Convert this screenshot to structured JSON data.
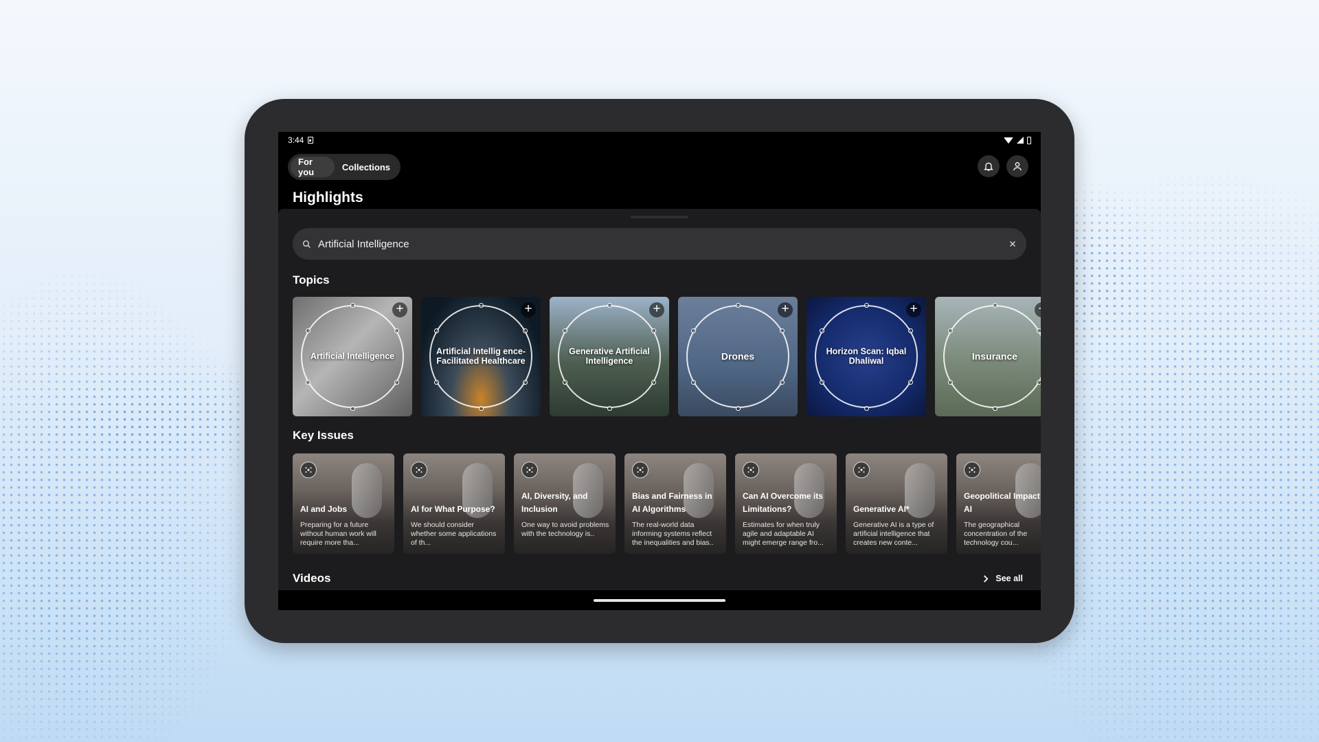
{
  "status_bar": {
    "time": "3:44"
  },
  "tabs": [
    {
      "label": "For you",
      "active": true
    },
    {
      "label": "Collections",
      "active": false
    }
  ],
  "header": {
    "title": "Highlights"
  },
  "search": {
    "value": "Artificial Intelligence"
  },
  "sections": {
    "topics": "Topics",
    "key_issues": "Key Issues",
    "videos": "Videos",
    "see_all": "See all"
  },
  "topics": [
    {
      "label": "Artificial Intelligence"
    },
    {
      "label": "Artificial Intellig ence-Facilitated Healthcare"
    },
    {
      "label": "Generative Artificial Intelligence"
    },
    {
      "label": "Drones"
    },
    {
      "label": "Horizon Scan: Iqbal Dhaliwal"
    },
    {
      "label": "Insurance"
    }
  ],
  "key_issues": [
    {
      "title": "AI and Jobs",
      "desc": "Preparing for a future without human work will require more tha..."
    },
    {
      "title": "AI for What Purpose?",
      "desc": "We should consider whether some applications of th..."
    },
    {
      "title": "AI, Diversity, and Inclusion",
      "desc": "One way to avoid problems with the technology is.."
    },
    {
      "title": "Bias and Fairness in AI Algorithms",
      "desc": "The real-world data informing systems reflect the inequalities and bias.."
    },
    {
      "title": "Can AI Overcome its Limitations?",
      "desc": "Estimates for when truly agile and adaptable AI might emerge range fro..."
    },
    {
      "title": "Generative AI*",
      "desc": "Generative AI is a type of artificial intelligence that creates new conte..."
    },
    {
      "title": "Geopolitical Impact of AI",
      "desc": "The geographical concentration of the technology cou..."
    }
  ],
  "colors": {
    "sheet": "#1c1c1e",
    "search": "#333335",
    "accent_dots": "#4a90e2"
  }
}
